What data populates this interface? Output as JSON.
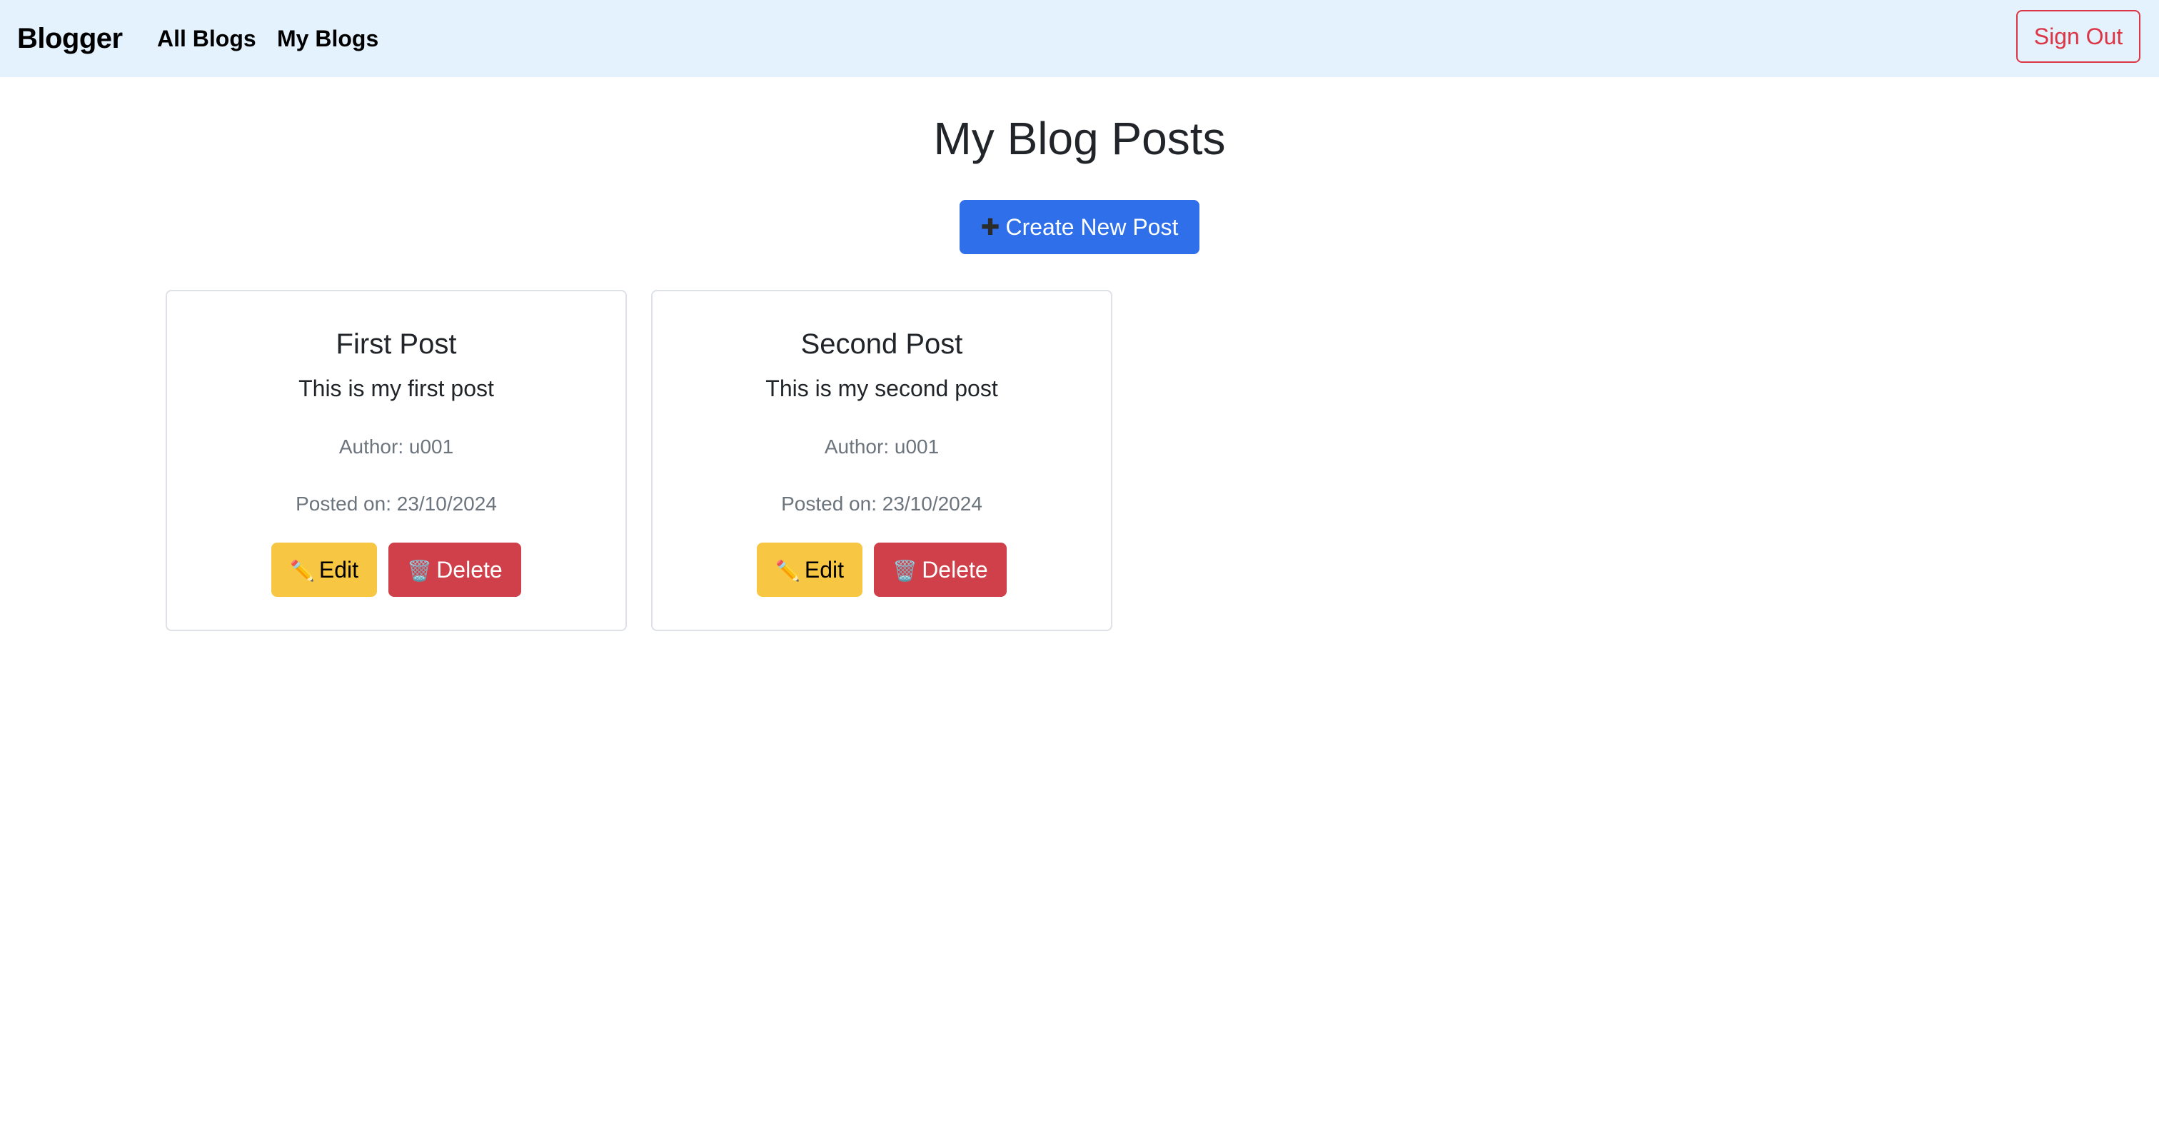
{
  "navbar": {
    "brand": "Blogger",
    "links": [
      {
        "label": "All Blogs"
      },
      {
        "label": "My Blogs"
      }
    ],
    "sign_out": "Sign Out"
  },
  "main": {
    "title": "My Blog Posts",
    "create_button": {
      "icon": "plus-icon",
      "glyph": "✚",
      "label": "Create New Post"
    }
  },
  "posts": [
    {
      "title": "First Post",
      "content": "This is my first post",
      "author": "Author: u001",
      "date": "Posted on: 23/10/2024",
      "edit_label": "Edit",
      "edit_glyph": "✏️",
      "delete_label": "Delete",
      "delete_glyph": "🗑️"
    },
    {
      "title": "Second Post",
      "content": "This is my second post",
      "author": "Author: u001",
      "date": "Posted on: 23/10/2024",
      "edit_label": "Edit",
      "edit_glyph": "✏️",
      "delete_label": "Delete",
      "delete_glyph": "🗑️"
    }
  ],
  "colors": {
    "navbar_bg": "#e3f2fd",
    "primary": "#2f6fea",
    "warning": "#f7c744",
    "danger": "#d0404a",
    "muted": "#6c757d"
  }
}
